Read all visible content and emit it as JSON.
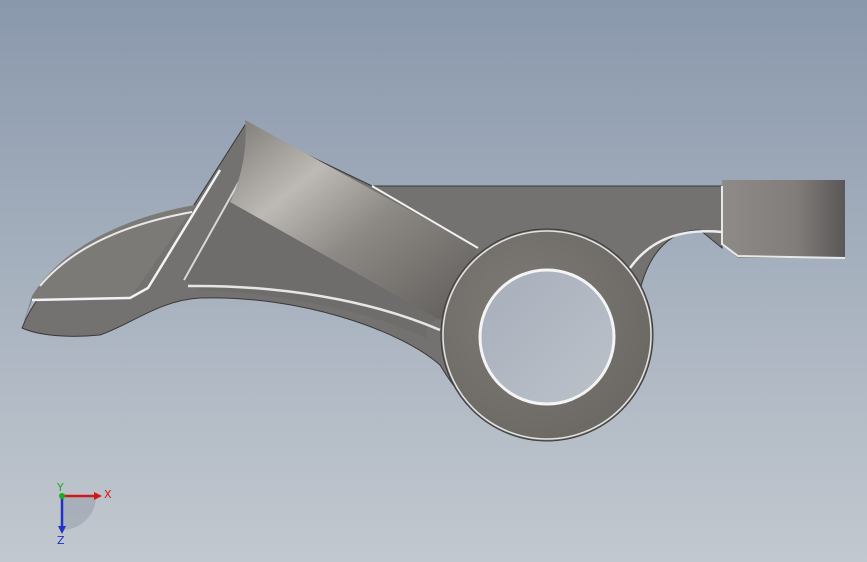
{
  "viewport": {
    "background_top": "#8a98ac",
    "background_bottom": "#c2c8cf"
  },
  "model": {
    "kind": "rocker-arm-part",
    "face_color": "#767370",
    "edge_color": "#ffffff"
  },
  "triad": {
    "x_label": "X",
    "y_label": "Y",
    "z_label": "Z",
    "x_color": "#d01818",
    "y_color": "#18b018",
    "z_color": "#2030c8"
  }
}
